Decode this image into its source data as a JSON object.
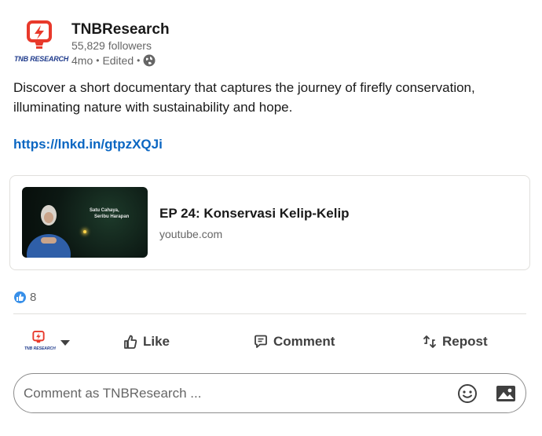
{
  "author": {
    "name": "TNBResearch",
    "followers": "55,829 followers",
    "age": "4mo",
    "edited": "Edited",
    "logo_text": "TNB RESEARCH",
    "brand_color": "#e8392b"
  },
  "post": {
    "text": "Discover a short documentary that captures the journey of firefly conservation, illuminating nature with sustainability and hope.",
    "link": "https://lnkd.in/gtpzXQJi"
  },
  "article": {
    "title": "EP 24: Konservasi Kelip-Kelip",
    "source": "youtube.com",
    "thumbnail_caption_line1": "Satu Cahaya,",
    "thumbnail_caption_line2": "Seribu Harapan"
  },
  "social": {
    "reaction_icon": "like-icon",
    "reaction_count": "8"
  },
  "actions": {
    "like": "Like",
    "comment": "Comment",
    "repost": "Repost"
  },
  "comment_box": {
    "placeholder": "Comment as TNBResearch ..."
  },
  "colors": {
    "link": "#0a66c2",
    "like_blue": "#378fe9"
  }
}
